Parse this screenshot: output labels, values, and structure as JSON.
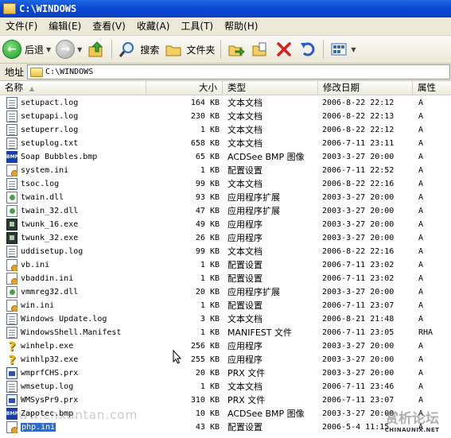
{
  "window": {
    "title": "C:\\WINDOWS"
  },
  "menu": [
    "文件(F)",
    "编辑(E)",
    "查看(V)",
    "收藏(A)",
    "工具(T)",
    "帮助(H)"
  ],
  "toolbar": {
    "back_label": "后退",
    "search_label": "搜索",
    "folders_label": "文件夹"
  },
  "address": {
    "label": "地址",
    "value": "C:\\WINDOWS"
  },
  "columns": {
    "name": "名称",
    "size": "大小",
    "type": "类型",
    "modified": "修改日期",
    "attr": "属性"
  },
  "files": [
    {
      "name": "setupact.log",
      "size": "164 KB",
      "type": "文本文档",
      "date": "2006-8-22 22:12",
      "attr": "A",
      "icon": "doc"
    },
    {
      "name": "setupapi.log",
      "size": "230 KB",
      "type": "文本文档",
      "date": "2006-8-22 22:13",
      "attr": "A",
      "icon": "doc"
    },
    {
      "name": "setuperr.log",
      "size": "1 KB",
      "type": "文本文档",
      "date": "2006-8-22 22:12",
      "attr": "A",
      "icon": "doc"
    },
    {
      "name": "setuplog.txt",
      "size": "658 KB",
      "type": "文本文档",
      "date": "2006-7-11 23:11",
      "attr": "A",
      "icon": "doc"
    },
    {
      "name": "Soap Bubbles.bmp",
      "size": "65 KB",
      "type": "ACDSee BMP 图像",
      "date": "2003-3-27 20:00",
      "attr": "A",
      "icon": "bmp"
    },
    {
      "name": "system.ini",
      "size": "1 KB",
      "type": "配置设置",
      "date": "2006-7-11 22:52",
      "attr": "A",
      "icon": "ini"
    },
    {
      "name": "tsoc.log",
      "size": "99 KB",
      "type": "文本文档",
      "date": "2006-8-22 22:16",
      "attr": "A",
      "icon": "doc"
    },
    {
      "name": "twain.dll",
      "size": "93 KB",
      "type": "应用程序扩展",
      "date": "2003-3-27 20:00",
      "attr": "A",
      "icon": "dll"
    },
    {
      "name": "twain_32.dll",
      "size": "47 KB",
      "type": "应用程序扩展",
      "date": "2003-3-27 20:00",
      "attr": "A",
      "icon": "dll"
    },
    {
      "name": "twunk_16.exe",
      "size": "49 KB",
      "type": "应用程序",
      "date": "2003-3-27 20:00",
      "attr": "A",
      "icon": "exe"
    },
    {
      "name": "twunk_32.exe",
      "size": "26 KB",
      "type": "应用程序",
      "date": "2003-3-27 20:00",
      "attr": "A",
      "icon": "exe"
    },
    {
      "name": "uddisetup.log",
      "size": "99 KB",
      "type": "文本文档",
      "date": "2006-8-22 22:16",
      "attr": "A",
      "icon": "doc"
    },
    {
      "name": "vb.ini",
      "size": "1 KB",
      "type": "配置设置",
      "date": "2006-7-11 23:02",
      "attr": "A",
      "icon": "ini"
    },
    {
      "name": "vbaddin.ini",
      "size": "1 KB",
      "type": "配置设置",
      "date": "2006-7-11 23:02",
      "attr": "A",
      "icon": "ini"
    },
    {
      "name": "vmmreg32.dll",
      "size": "20 KB",
      "type": "应用程序扩展",
      "date": "2003-3-27 20:00",
      "attr": "A",
      "icon": "dll"
    },
    {
      "name": "win.ini",
      "size": "1 KB",
      "type": "配置设置",
      "date": "2006-7-11 23:07",
      "attr": "A",
      "icon": "ini"
    },
    {
      "name": "Windows Update.log",
      "size": "3 KB",
      "type": "文本文档",
      "date": "2006-8-21 21:48",
      "attr": "A",
      "icon": "doc"
    },
    {
      "name": "WindowsShell.Manifest",
      "size": "1 KB",
      "type": "MANIFEST 文件",
      "date": "2006-7-11 23:05",
      "attr": "RHA",
      "icon": "doc"
    },
    {
      "name": "winhelp.exe",
      "size": "256 KB",
      "type": "应用程序",
      "date": "2003-3-27 20:00",
      "attr": "A",
      "icon": "help"
    },
    {
      "name": "winhlp32.exe",
      "size": "255 KB",
      "type": "应用程序",
      "date": "2003-3-27 20:00",
      "attr": "A",
      "icon": "help"
    },
    {
      "name": "wmprfCHS.prx",
      "size": "20 KB",
      "type": "PRX 文件",
      "date": "2003-3-27 20:00",
      "attr": "A",
      "icon": "prx"
    },
    {
      "name": "wmsetup.log",
      "size": "1 KB",
      "type": "文本文档",
      "date": "2006-7-11 23:46",
      "attr": "A",
      "icon": "doc"
    },
    {
      "name": "WMSysPr9.prx",
      "size": "310 KB",
      "type": "PRX 文件",
      "date": "2006-7-11 23:07",
      "attr": "A",
      "icon": "prx"
    },
    {
      "name": "Zapotec.bmp",
      "size": "10 KB",
      "type": "ACDSee BMP 图像",
      "date": "2003-3-27 20:00",
      "attr": "A",
      "icon": "bmp"
    },
    {
      "name": "php.ini",
      "size": "43 KB",
      "type": "配置设置",
      "date": "2006-5-4 11:15",
      "attr": "A",
      "icon": "ini",
      "selected": true
    }
  ],
  "watermarks": {
    "left": "www.cnxuntan.com",
    "right_top": "赏析论坛",
    "right_bottom": "CHINAUNIX.NET"
  }
}
